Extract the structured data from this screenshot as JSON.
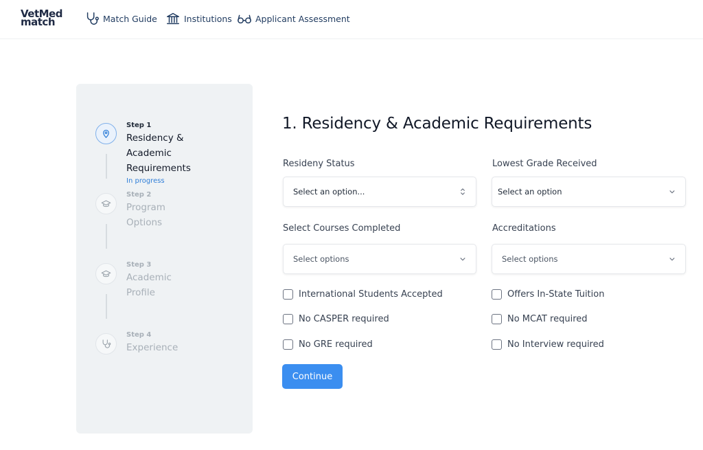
{
  "brand": {
    "line1": "VetMed",
    "line2": "match"
  },
  "nav": [
    {
      "label": "Match Guide",
      "icon": "stethoscope-icon"
    },
    {
      "label": "Institutions",
      "icon": "institution-icon"
    },
    {
      "label": "Applicant Assessment",
      "icon": "glasses-icon"
    }
  ],
  "steps": [
    {
      "num": "Step 1",
      "title_line1": "Residency & Academic",
      "title_line2": "Requirements",
      "status": "In progress",
      "icon": "location-pin-icon",
      "active": true
    },
    {
      "num": "Step 2",
      "title_line1": "Program Options",
      "icon": "graduation-cap-icon",
      "active": false
    },
    {
      "num": "Step 3",
      "title_line1": "Academic Profile",
      "icon": "graduation-cap-icon",
      "active": false
    },
    {
      "num": "Step 4",
      "title_line1": "Experience",
      "icon": "stethoscope-icon",
      "active": false
    }
  ],
  "form": {
    "title": "1. Residency & Academic Requirements",
    "fields": [
      {
        "label": "Resideny Status",
        "value": "Select an option...",
        "icon": "updown-chevron-icon"
      },
      {
        "label": "Lowest Grade Received",
        "value": "Select an option",
        "icon": "chevron-down-icon"
      },
      {
        "label": "Select Courses Completed",
        "value": "Select options",
        "icon": "chevron-down-icon"
      },
      {
        "label": "Accreditations",
        "value": "Select options",
        "icon": "chevron-down-icon"
      }
    ],
    "checkboxes": [
      {
        "label": "International Students Accepted",
        "checked": false
      },
      {
        "label": "Offers In-State Tuition",
        "checked": false
      },
      {
        "label": "No CASPER required",
        "checked": false
      },
      {
        "label": "No MCAT required",
        "checked": false
      },
      {
        "label": "No GRE required",
        "checked": false
      },
      {
        "label": "No Interview required",
        "checked": false
      }
    ],
    "continue_label": "Continue"
  },
  "colors": {
    "accent": "#3b8ef0",
    "sidebar_bg": "#eff2f4",
    "status": "#2f7ed8"
  }
}
